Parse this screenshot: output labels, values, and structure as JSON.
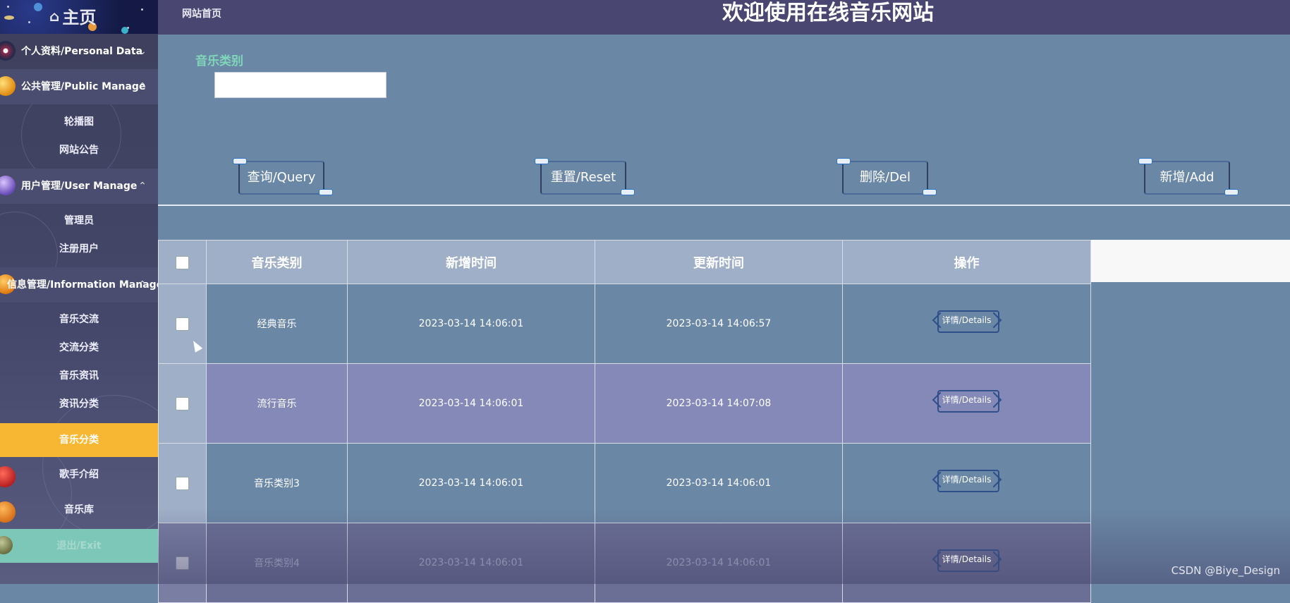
{
  "sidebar": {
    "logo_text": "主页",
    "groups": [
      {
        "label": "个人资料/Personal Data",
        "expanded": false
      },
      {
        "label": "公共管理/Public Manage",
        "expanded": true,
        "items": [
          "轮播图",
          "网站公告"
        ]
      },
      {
        "label": "用户管理/User Manage",
        "expanded": true,
        "items": [
          "管理员",
          "注册用户"
        ]
      },
      {
        "label": "信息管理/Information Manage",
        "expanded": true,
        "items": [
          "音乐交流",
          "交流分类",
          "音乐资讯",
          "资讯分类",
          "音乐分类"
        ]
      }
    ],
    "extra_items": [
      "歌手介绍",
      "音乐库"
    ],
    "active_item": "音乐分类",
    "exit_label": "退出/Exit"
  },
  "topbar": {
    "breadcrumb": "网站首页",
    "site_title": "欢迎使用在线音乐网站"
  },
  "filter": {
    "label": "音乐类别",
    "value": ""
  },
  "buttons": {
    "query": "查询/Query",
    "reset": "重置/Reset",
    "delete": "删除/Del",
    "add": "新增/Add"
  },
  "table": {
    "headers": [
      "音乐类别",
      "新增时间",
      "更新时间",
      "操作"
    ],
    "details_label": "详情/Details",
    "rows": [
      {
        "category": "经典音乐",
        "created": "2023-03-14 14:06:01",
        "updated": "2023-03-14 14:06:57"
      },
      {
        "category": "流行音乐",
        "created": "2023-03-14 14:06:01",
        "updated": "2023-03-14 14:07:08"
      },
      {
        "category": "音乐类别3",
        "created": "2023-03-14 14:06:01",
        "updated": "2023-03-14 14:06:01"
      },
      {
        "category": "音乐类别4",
        "created": "2023-03-14 14:06:01",
        "updated": "2023-03-14 14:06:01"
      }
    ]
  },
  "watermark": "CSDN @Biye_Design",
  "colors": {
    "topbar": "#4a4672",
    "content_bg": "#6b87a6",
    "active_menu": "#f7b733",
    "exit_menu": "#7dc7b8",
    "filter_label": "#7fd6b8"
  }
}
